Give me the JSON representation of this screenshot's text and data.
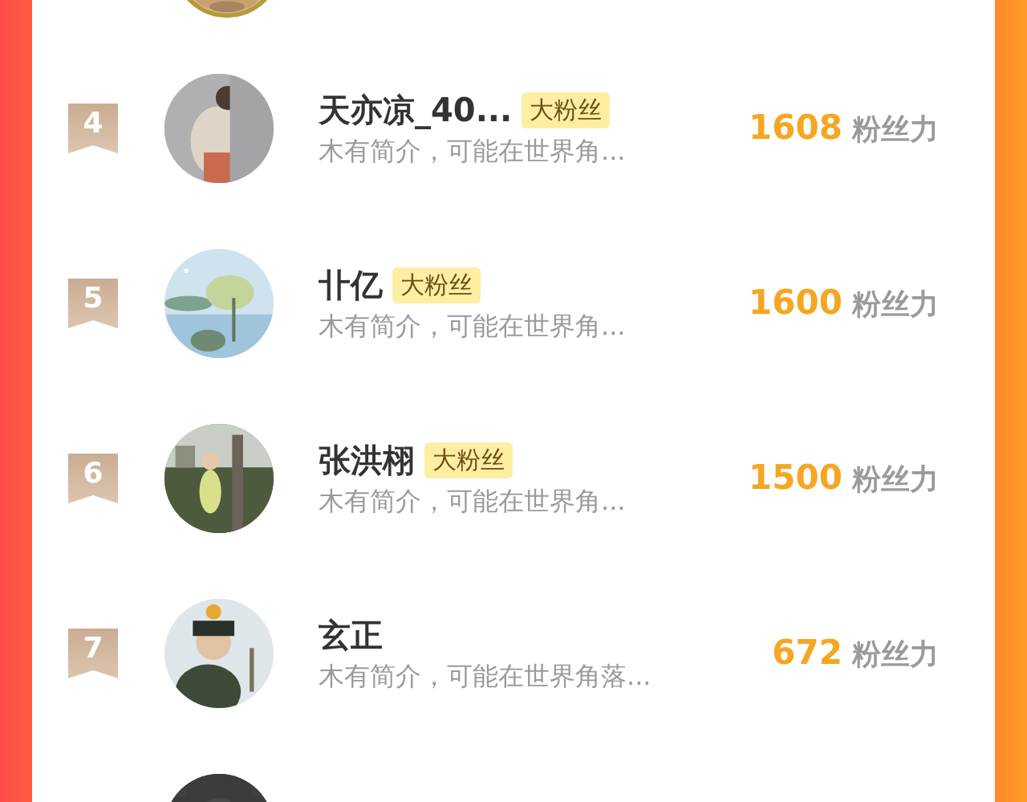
{
  "rows": [
    {
      "rank": "4",
      "name": "天亦凉_40...",
      "badge": "大粉丝",
      "intro": "木有简介，可能在世界角...",
      "score": "1608",
      "unit": "粉丝力"
    },
    {
      "rank": "5",
      "name": "卝亿",
      "badge": "大粉丝",
      "intro": "木有简介，可能在世界角...",
      "score": "1600",
      "unit": "粉丝力"
    },
    {
      "rank": "6",
      "name": "张洪栩",
      "badge": "大粉丝",
      "intro": "木有简介，可能在世界角...",
      "score": "1500",
      "unit": "粉丝力"
    },
    {
      "rank": "7",
      "name": "玄正",
      "intro": "木有简介，可能在世界角落...",
      "score": "672",
      "unit": "粉丝力"
    }
  ]
}
